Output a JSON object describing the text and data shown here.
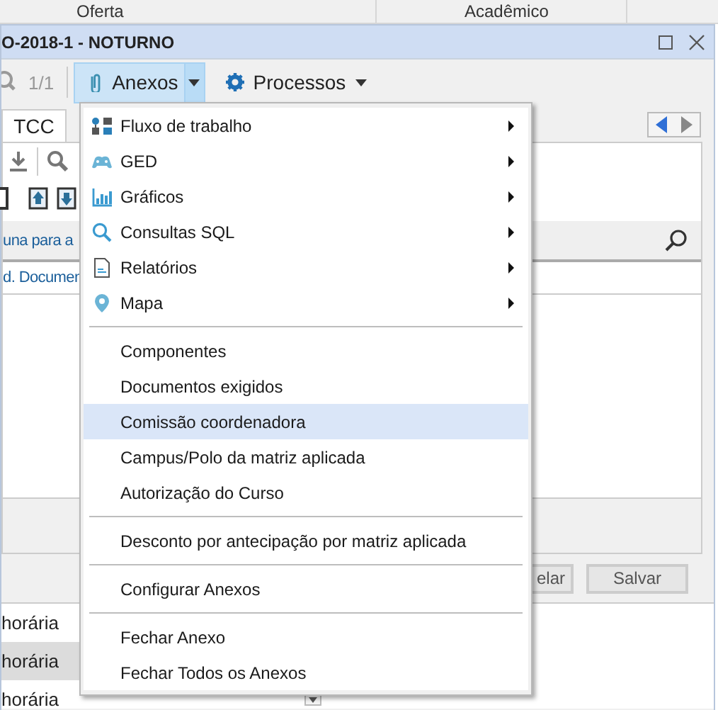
{
  "header": {
    "columns": [
      "Oferta",
      "Acadêmico"
    ]
  },
  "window": {
    "title": "O-2018-1 - NOTURNO"
  },
  "toolbar": {
    "record_counter": "1/1",
    "buttons": [
      {
        "label": "Anexos",
        "selected": true
      },
      {
        "label": "Processos",
        "selected": false
      }
    ]
  },
  "tabs": [
    {
      "label": "TCC",
      "selected": true
    }
  ],
  "panel": {
    "group_hint": "una para a",
    "column_header": "d. Documen",
    "buttons": [
      "elar",
      "Salvar"
    ]
  },
  "list": [
    {
      "text": "horária",
      "selected": false
    },
    {
      "text": "horária",
      "selected": true
    },
    {
      "text": "horária",
      "selected": false
    }
  ],
  "menu": {
    "items": [
      {
        "kind": "submenu",
        "label": "Fluxo de trabalho",
        "selected": false
      },
      {
        "kind": "submenu",
        "label": "GED",
        "selected": false
      },
      {
        "kind": "submenu",
        "label": "Gráficos",
        "selected": false
      },
      {
        "kind": "submenu",
        "label": "Consultas SQL",
        "selected": false
      },
      {
        "kind": "submenu",
        "label": "Relatórios",
        "selected": false
      },
      {
        "kind": "submenu",
        "label": "Mapa",
        "selected": false
      },
      {
        "kind": "separator"
      },
      {
        "kind": "action",
        "label": "Componentes",
        "selected": false
      },
      {
        "kind": "action",
        "label": "Documentos exigidos",
        "selected": false
      },
      {
        "kind": "action",
        "label": "Comissão coordenadora",
        "selected": true
      },
      {
        "kind": "action",
        "label": "Campus/Polo da matriz aplicada",
        "selected": false
      },
      {
        "kind": "action",
        "label": "Autorização do Curso",
        "selected": false
      },
      {
        "kind": "separator"
      },
      {
        "kind": "action",
        "label": "Desconto por antecipação por matriz aplicada",
        "selected": false
      },
      {
        "kind": "separator"
      },
      {
        "kind": "action",
        "label": "Configurar Anexos",
        "selected": false
      },
      {
        "kind": "separator"
      },
      {
        "kind": "action",
        "label": "Fechar Anexo",
        "selected": false
      },
      {
        "kind": "action",
        "label": "Fechar Todos os Anexos",
        "selected": false
      }
    ]
  }
}
